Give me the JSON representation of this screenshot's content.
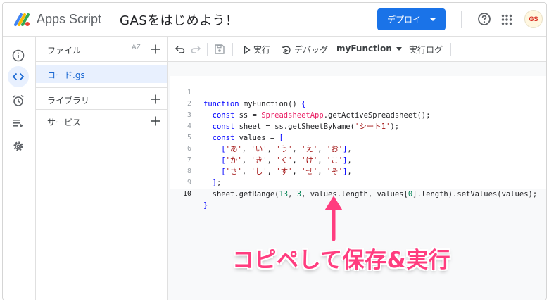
{
  "app": {
    "brand": "Apps Script",
    "project_title": "GASをはじめよう！"
  },
  "header": {
    "deploy_label": "デプロイ",
    "avatar_text": "GS"
  },
  "rail": {
    "items": [
      "info-icon",
      "code-icon",
      "alarm-icon",
      "list-play-icon",
      "gear-icon"
    ]
  },
  "files": {
    "title": "ファイル",
    "sort_label": "AZ",
    "items": [
      {
        "label": "コード.gs"
      }
    ],
    "sections": [
      {
        "label": "ライブラリ"
      },
      {
        "label": "サービス"
      }
    ]
  },
  "toolbar": {
    "run_label": "実行",
    "debug_label": "デバッグ",
    "function_label": "myFunction",
    "log_label": "実行ログ"
  },
  "editor": {
    "line_numbers": [
      "1",
      "2",
      "3",
      "4",
      "5",
      "6",
      "7",
      "8",
      "9",
      "10"
    ],
    "lines": [
      "function myFunction() {",
      "  const ss = SpreadsheetApp.getActiveSpreadsheet();",
      "  const sheet = ss.getSheetByName('シート1');",
      "  const values = [",
      "    ['あ', 'い', 'う', 'え', 'お'],",
      "    ['か', 'き', 'く', 'け', 'こ'],",
      "    ['さ', 'し', 'す', 'せ', 'そ'],",
      "  ];",
      "  sheet.getRange(13, 3, values.length, values[0].length).setValues(values);",
      "}"
    ]
  },
  "annotation": {
    "text": "コピペして保存&実行",
    "color": "#ff3d7f"
  },
  "colors": {
    "accent": "#1a73e8",
    "selected_bg": "#e8f0fe",
    "keyword": "#0000ff",
    "class": "#e91e63",
    "string": "#a31515"
  }
}
